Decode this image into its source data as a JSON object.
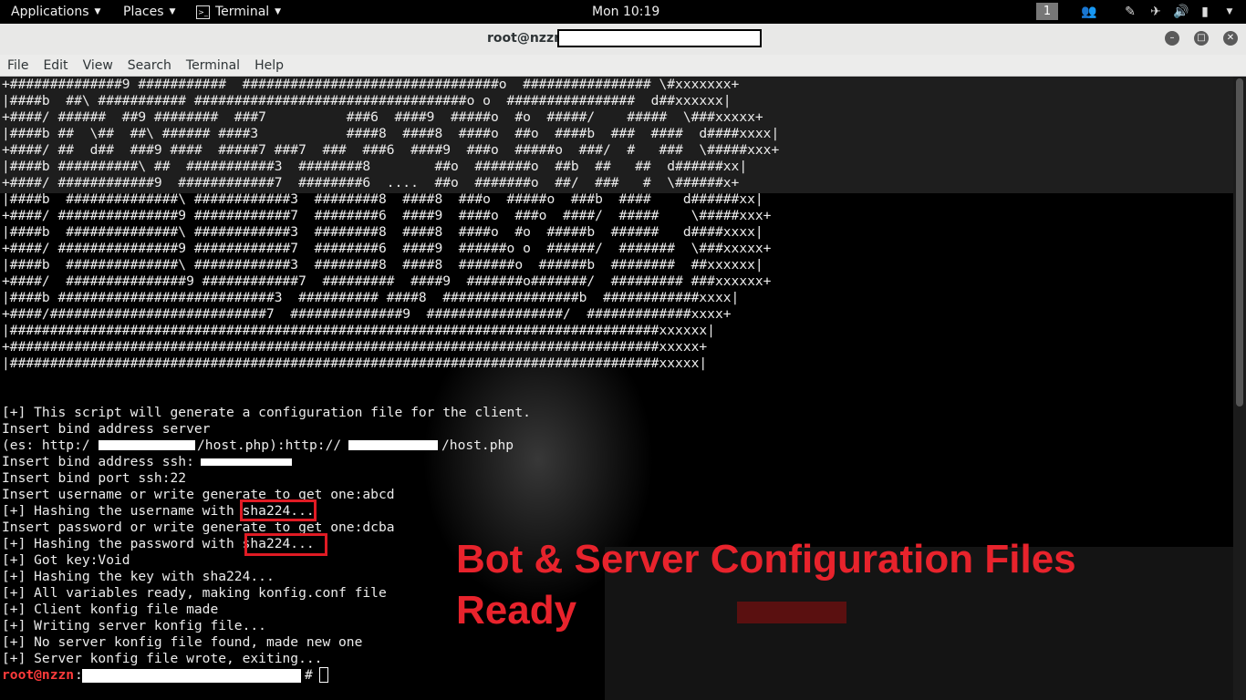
{
  "topbar": {
    "applications": "Applications",
    "places": "Places",
    "terminal_app": "Terminal",
    "clock": "Mon 10:19",
    "workspace": "1"
  },
  "window": {
    "title": "root@nzzn:"
  },
  "menu": [
    "File",
    "Edit",
    "View",
    "Search",
    "Terminal",
    "Help"
  ],
  "ascii_art": [
    "+##############9 ###########  ################################o  ################ \\#xxxxxxx+",
    "|####b  ##\\ ########### ##################################o o  ################  d##xxxxxx|",
    "+####/ ######  ##9 ########  ###7          ###6  ####9  #####o  #o  #####/    #####  \\###xxxxx+",
    "|####b ##  \\##  ##\\ ###### ####3           ####8  ####8  ####o  ##o  ####b  ###  ####  d####xxxx|",
    "+####/ ##  d##  ###9 ####  #####7 ###7  ###  ###6  ####9  ###o  #####o  ###/  #   ###  \\#####xxx+",
    "|####b ##########\\ ##  ###########3  ########8        ##o  #######o  ##b  ##   ##  d######xx|",
    "+####/ ############9  ############7  ########6  ....  ##o  #######o  ##/  ###   #  \\######x+",
    "|####b  ##############\\ ############3  ########8  ####8  ###o  #####o  ###b  ####    d######xx|",
    "+####/ ###############9 ############7  ########6  ####9  ####o  ###o  ####/  #####    \\#####xxx+",
    "|####b  ##############\\ ############3  ########8  ####8  ####o  #o  #####b  ######   d####xxxx|",
    "+####/ ###############9 ############7  ########6  ####9  ######o o  ######/  #######  \\###xxxxx+",
    "|####b  ##############\\ ############3  ########8  ####8  #######o  ######b  ########  ##xxxxxx|",
    "+####/  ###############9 ############7  #########  ####9  #######o#######/  ######### ###xxxxxx+",
    "|####b ###########################3  ########## ####8  #################b  ############xxxx|",
    "+####/###########################7  ##############9  #################/  #############xxxx+",
    "|#################################################################################xxxxxx|",
    "+#################################################################################xxxxx+",
    "|#################################################################################xxxxx|"
  ],
  "output": {
    "line1": "[+] This script will generate a configuration file for the client.",
    "line2": "Insert bind address server",
    "line3a": "(es: http:/",
    "line3b": "/host.php):http://",
    "line3c": "/host.php",
    "line4": "Insert bind address ssh:",
    "line5": "Insert bind port ssh:22",
    "line6": "Insert username or write generate to get one:abcd",
    "line7": "[+] Hashing the username with sha224...",
    "line8": "Insert password or write generate to get one:dcba",
    "line9": "[+] Hashing the password with sha224...",
    "line10": "[+] Got key:Void",
    "line11": "[+] Hashing the key with sha224...",
    "line12": "[+] All variables ready, making konfig.conf file",
    "line13": "[+] Client konfig file made",
    "line14": "[+] Writing server konfig file...",
    "line15": "[+] No server konfig file found, made new one",
    "line16": "[+] Server konfig file wrote, exiting..."
  },
  "prompt": {
    "user": "root@nzzn",
    "sep": ":",
    "hash": "#"
  },
  "overlay": {
    "line1": "Bot & Server Configuration Files",
    "line2": "Ready"
  },
  "colors": {
    "highlight": "#e01b24",
    "overlay_text": "#e8232c",
    "prompt_user": "#ff3b3b"
  }
}
